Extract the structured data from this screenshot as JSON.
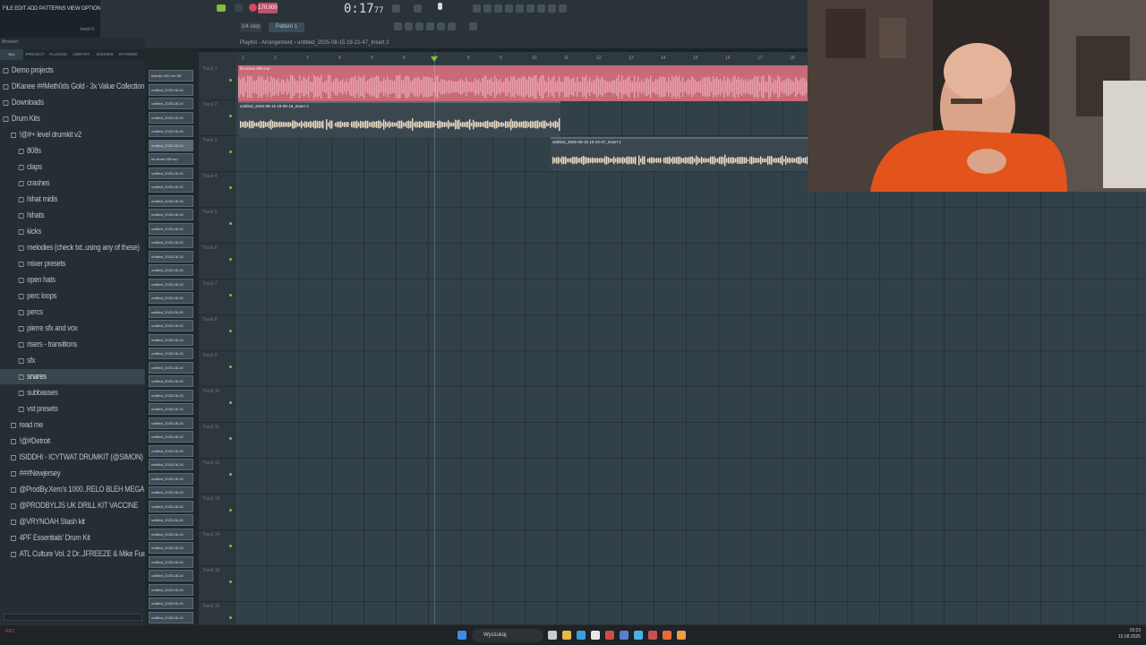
{
  "menubar": {
    "text": "FILE  EDIT  ADD  PATTERNS  VIEW  OPTIONS  TOOLS  HELP"
  },
  "toolbar": {
    "time": "0:17",
    "time_suffix": "77",
    "tempo": "170.000",
    "snap": "1/4 step",
    "pattern": "Pattern 1",
    "track_label": "track 6"
  },
  "browser": {
    "title": "Browser",
    "tabs": [
      "ALL",
      "PROJECT",
      "PLUGINS",
      "LIBRARY",
      "SOUNDS",
      "STARRED"
    ],
    "items": [
      {
        "label": "Demo projects",
        "level": 0,
        "selected": false
      },
      {
        "label": "DKanee ##Meth0ds Gold - 3x Value Collection",
        "level": 0,
        "selected": false
      },
      {
        "label": "Downloads",
        "level": 0,
        "selected": false
      },
      {
        "label": "Drum Kits",
        "level": 0,
        "selected": false
      },
      {
        "label": "!@#+ level drumkit v2",
        "level": 1,
        "selected": false
      },
      {
        "label": "808s",
        "level": 2,
        "selected": false
      },
      {
        "label": "claps",
        "level": 2,
        "selected": false
      },
      {
        "label": "crashes",
        "level": 2,
        "selected": false
      },
      {
        "label": "hihat midis",
        "level": 2,
        "selected": false
      },
      {
        "label": "hihats",
        "level": 2,
        "selected": false
      },
      {
        "label": "kicks",
        "level": 2,
        "selected": false
      },
      {
        "label": "melodies (check txt..using any of these)",
        "level": 2,
        "selected": false
      },
      {
        "label": "mixer presets",
        "level": 2,
        "selected": false
      },
      {
        "label": "open hats",
        "level": 2,
        "selected": false
      },
      {
        "label": "perc loops",
        "level": 2,
        "selected": false
      },
      {
        "label": "percs",
        "level": 2,
        "selected": false
      },
      {
        "label": "pierre sfx and vox",
        "level": 2,
        "selected": false
      },
      {
        "label": "risers - transitions",
        "level": 2,
        "selected": false
      },
      {
        "label": "sfx",
        "level": 2,
        "selected": false
      },
      {
        "label": "snares",
        "level": 2,
        "selected": true
      },
      {
        "label": "subbasses",
        "level": 2,
        "selected": false
      },
      {
        "label": "vst presets",
        "level": 2,
        "selected": false
      },
      {
        "label": "read me",
        "level": 1,
        "selected": false
      },
      {
        "label": "!@#Detroit",
        "level": 1,
        "selected": false
      },
      {
        "label": "ISIDDHI - ICYTWAT DRUMKIT (@SIMON)",
        "level": 1,
        "selected": false
      },
      {
        "label": "###Newjersey",
        "level": 1,
        "selected": false
      },
      {
        "label": "@ProdBy.Xero's 1000..RELO BLEH MEGA KIT",
        "level": 1,
        "selected": false
      },
      {
        "label": "@PRODBYLJS UK DRILL KIT VACCINE",
        "level": 1,
        "selected": false
      },
      {
        "label": "@VRYNOAH Stash kit",
        "level": 1,
        "selected": false
      },
      {
        "label": "4PF Essentials' Drum Kit",
        "level": 1,
        "selected": false
      },
      {
        "label": "ATL Culture Vol. 2 Dr..JFREEZE & Mike Fuego",
        "level": 1,
        "selected": false
      }
    ]
  },
  "channels": [
    "flstudio 232 ver 3B",
    "untitled_2025-08-15",
    "untitled_2025-08-15",
    "untitled_2025-08-15",
    "untitled_2025-08-15",
    "untitled_2025-08-15",
    "fst.alone 089.mp",
    "untitled_2025-08-15",
    "untitled_2025-08-15",
    "untitled_2025-08-15",
    "untitled_2025-08-15",
    "untitled_2025-08-15",
    "untitled_2025-08-15",
    "untitled_2025-08-15",
    "untitled_2025-08-15",
    "untitled_2025-08-15",
    "untitled_2025-08-15",
    "untitled_2025-08-15",
    "untitled_2025-08-15",
    "untitled_2025-08-15",
    "untitled_2025-08-15",
    "untitled_2025-08-15",
    "untitled_2025-08-15",
    "untitled_2025-08-15",
    "untitled_2025-08-15",
    "untitled_2025-08-15",
    "untitled_2025-08-15",
    "untitled_2025-08-15",
    "untitled_2025-08-15",
    "untitled_2025-08-15",
    "untitled_2025-08-15",
    "untitled_2025-08-15",
    "untitled_2025-08-15",
    "untitled_2025-08-15",
    "untitled_2025-08-15",
    "untitled_2025-08-15",
    "untitled_2025-08-15",
    "untitled_2025-08-15",
    "untitled_2025-08-15",
    "untitled_2025-08-15"
  ],
  "playlist": {
    "title": "Playlist - Arrangement",
    "subtitle": "untitled_2025-08-15 19-21-47_Insert 2",
    "tracks": [
      "Track 1",
      "Track 2",
      "Track 3",
      "Track 4",
      "Track 5",
      "Track 6",
      "Track 7",
      "Track 8",
      "Track 9",
      "Track 10",
      "Track 11",
      "Track 12",
      "Track 13",
      "Track 14",
      "Track 15",
      "Track 16"
    ],
    "ruler": [
      "1",
      "2",
      "3",
      "4",
      "5",
      "6",
      "7",
      "8",
      "9",
      "10",
      "11",
      "12",
      "13",
      "14",
      "15",
      "16",
      "17",
      "18"
    ],
    "clips": [
      {
        "label": "fst.alone 089.mp",
        "color": "#c86a78",
        "wave": "#e8a0ac"
      },
      {
        "label": "untitled_2025-08-15 19-08-18_Insert 2",
        "color": "#3b474f",
        "wave": "#f0e0c8"
      },
      {
        "label": "untitled_2025-08-15 19-23-47_Insert 2",
        "color": "#3b474f",
        "wave": "#f0e0c8"
      }
    ]
  },
  "taskbar": {
    "search": "Wyszukaj",
    "time": "19:23",
    "date": "15.08.2025",
    "rec": "REC"
  }
}
